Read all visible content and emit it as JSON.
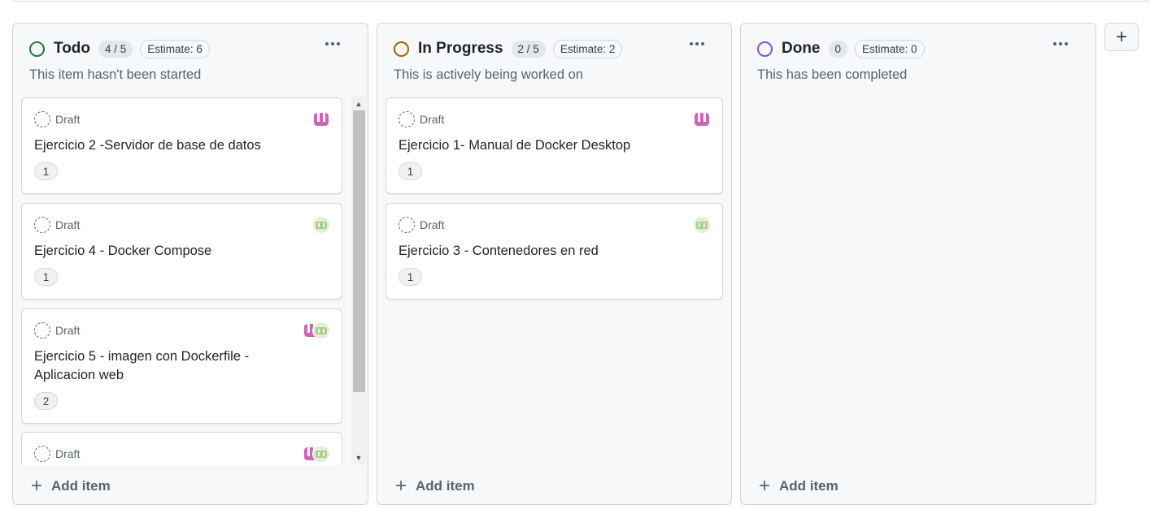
{
  "columns": [
    {
      "title": "Todo",
      "count": "4 / 5",
      "estimate": "Estimate: 6",
      "status_color": "#1a7f37",
      "description": "This item hasn't been started",
      "add_label": "Add item",
      "cards": [
        {
          "status": "Draft",
          "title": "Ejercicio 2 -Servidor de base de datos",
          "badge": "1",
          "assignees": [
            "pink-avatar"
          ]
        },
        {
          "status": "Draft",
          "title": "Ejercicio 4 - Docker Compose",
          "badge": "1",
          "assignees": [
            "green-avatar"
          ]
        },
        {
          "status": "Draft",
          "title": "Ejercicio 5 - imagen con Dockerfile - Aplicacion web",
          "badge": "2",
          "assignees": [
            "pink-avatar",
            "green-avatar"
          ]
        },
        {
          "status": "Draft",
          "title": "",
          "badge": "",
          "assignees": [
            "pink-avatar",
            "green-avatar"
          ]
        }
      ]
    },
    {
      "title": "In Progress",
      "count": "2 / 5",
      "estimate": "Estimate: 2",
      "status_color": "#9a6700",
      "description": "This is actively being worked on",
      "add_label": "Add item",
      "cards": [
        {
          "status": "Draft",
          "title": "Ejercicio 1- Manual de Docker Desktop",
          "badge": "1",
          "assignees": [
            "pink-avatar"
          ]
        },
        {
          "status": "Draft",
          "title": "Ejercicio 3 - Contenedores en red",
          "badge": "1",
          "assignees": [
            "green-avatar"
          ]
        }
      ]
    },
    {
      "title": "Done",
      "count": "0",
      "estimate": "Estimate: 0",
      "status_color": "#8250df",
      "description": "This has been completed",
      "add_label": "Add item",
      "cards": []
    }
  ],
  "add_column_label": "+",
  "avatar_colors": {
    "pink-avatar": "#d65fb8",
    "green-avatar": "#a8d08d"
  }
}
